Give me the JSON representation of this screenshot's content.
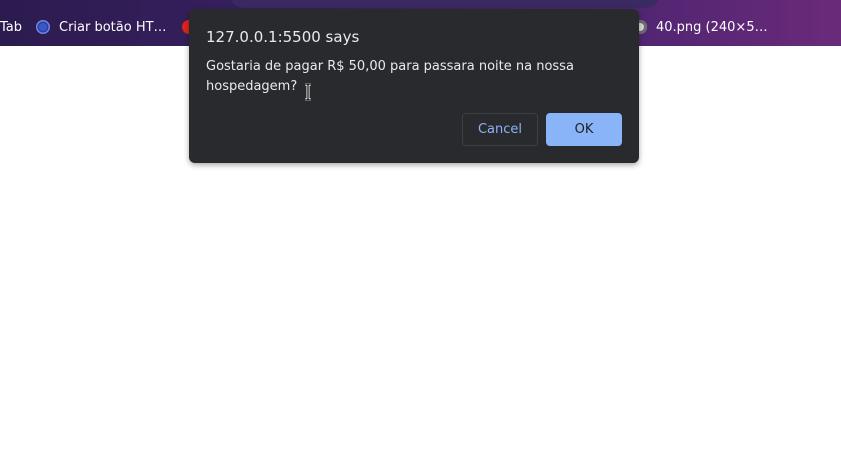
{
  "bookmarks": [
    {
      "label": "Tab",
      "icon": "none"
    },
    {
      "label": "Criar botão HT…",
      "icon": "globe-icon"
    },
    {
      "label": "",
      "icon": "red-dot-icon"
    },
    {
      "label": "40.png (240×5…",
      "icon": "github-icon"
    }
  ],
  "dialog": {
    "title": "127.0.0.1:5500 says",
    "message": "Gostaria de pagar R$ 50,00 para passara noite na nossa hospedagem?",
    "cancel_label": "Cancel",
    "ok_label": "OK"
  },
  "colors": {
    "dialog_bg": "#292a2d",
    "ok_bg": "#8ab4f8",
    "cancel_text": "#8ab4f8"
  }
}
